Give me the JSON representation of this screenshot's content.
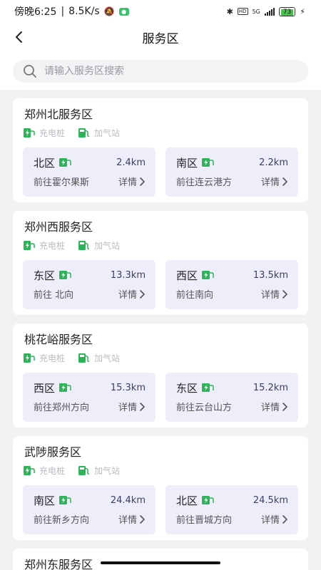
{
  "status_bar": {
    "time": "傍晚6:25",
    "speed": "8.5K/s",
    "network": "5G",
    "battery": "73"
  },
  "header": {
    "title": "服务区"
  },
  "search": {
    "placeholder": "请输入服务区搜索"
  },
  "facility_labels": {
    "charging": "充电桩",
    "gas": "加气站"
  },
  "detail_label": "详情",
  "service_areas": [
    {
      "name": "郑州北服务区",
      "zones": [
        {
          "name": "北区",
          "distance": "2.4km",
          "direction": "前往霍尔果斯"
        },
        {
          "name": "南区",
          "distance": "2.2km",
          "direction": "前往连云港方"
        }
      ]
    },
    {
      "name": "郑州西服务区",
      "zones": [
        {
          "name": "东区",
          "distance": "13.3km",
          "direction": "前往 北向"
        },
        {
          "name": "西区",
          "distance": "13.5km",
          "direction": "前往南向"
        }
      ]
    },
    {
      "name": "桃花峪服务区",
      "zones": [
        {
          "name": "西区",
          "distance": "15.3km",
          "direction": "前往郑州方向"
        },
        {
          "name": "东区",
          "distance": "15.2km",
          "direction": "前往云台山方"
        }
      ]
    },
    {
      "name": "武陟服务区",
      "zones": [
        {
          "name": "南区",
          "distance": "24.4km",
          "direction": "前往新乡方向"
        },
        {
          "name": "北区",
          "distance": "24.5km",
          "direction": "前往晋城方向"
        }
      ]
    },
    {
      "name": "郑州东服务区",
      "zones": []
    }
  ],
  "colors": {
    "zone_bg": "#eeedfa",
    "icon_green": "#2fb35a",
    "page_bg": "#f1f2f4"
  }
}
